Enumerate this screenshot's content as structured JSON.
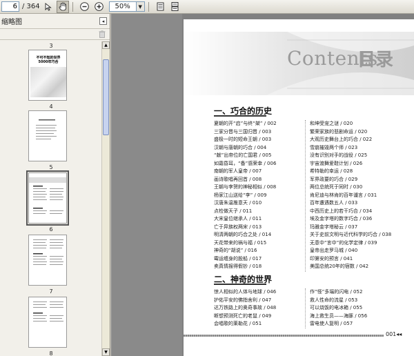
{
  "toolbar": {
    "current_page": "6",
    "page_total": "/ 364",
    "zoom": "50%"
  },
  "panel": {
    "title": "缩略图",
    "collapse_glyph": "◂"
  },
  "thumbnails": [
    {
      "label": "3"
    },
    {
      "label": "4",
      "cover_title": "不可不知的世界\n5000年巧合"
    },
    {
      "label": "5"
    },
    {
      "label": "6"
    },
    {
      "label": "7"
    },
    {
      "label": "8"
    }
  ],
  "page": {
    "banner_en": "Contents",
    "banner_cn": "目录",
    "page_number": "001◂◂"
  },
  "section1": {
    "title": "一、巧合的历史",
    "left": [
      "夏朝的开“启”与终“桀” / 002",
      "三家分晋与三国归晋 / 003",
      "盛极一时的短命王朝 / 003",
      "汉朝与唐朝的巧合 / 004",
      "“献”出帝位的亡国君 / 005",
      "如霜昏耳，“备”感荣幸 / 006",
      "南朝的军人皇帝 / 007",
      "画诗歌唱再回首 / 008",
      "王朝与李贺的神秘相似 / 008",
      "杨家江山送给“李” / 009",
      "汉唐朱温推意天 / 010",
      "点检做天子 / 011",
      "大宋皇位继承人 / 011",
      "亡于异族权两宋 / 013",
      "明清两朝的巧合之处 / 014",
      "天花带来的祸与福 / 015",
      "神奇的“胡说” / 016",
      "霉运缠身的股船 / 017",
      "卖真情报得假钞 / 018"
    ],
    "right": [
      "和坤受宠之谜 / 020",
      "繁荣家族的悲剧命运 / 020",
      "大观历史舞台上的巧合 / 022",
      "雪崩摧毁两个师 / 023",
      "没有识别对手的战役 / 025",
      "宇宙渡舞爱鞋计划 / 026",
      "希特勒的幸运 / 028",
      "军界政要的巧合 / 029",
      "两位总统死于同时 / 030",
      "肯尼迪与林肯的百年谶言 / 031",
      "百年遭遇数五人 / 033",
      "中西历史上的若干巧合 / 034",
      "埃及金字塔的数字巧合 / 036",
      "玛雅金字塔秘云 / 037",
      "关于史前文明与近代科学的巧合 / 038",
      "无意中“言中”的化学定律 / 039",
      "皇帝出走罗马城 / 040",
      "印第安的预言 / 041",
      "美国总统20年的宿数 / 042"
    ]
  },
  "section2": {
    "title": "二、神奇的世界",
    "left": [
      "惊人相似的人体与地球 / 046",
      "护佑平安的佛指舍利 / 047",
      "达万铁路上的奥奇事故 / 048",
      "断想预测死亡的老鼠 / 049",
      "会唱歌的莱勒花 / 051"
    ],
    "right": [
      "作“怪”多端的闪电 / 052",
      "救人性命的流星 / 053",
      "可以烧饭的电冰箱 / 055",
      "海上救生员——海豚 / 056",
      "雷电使人复明 / 057"
    ]
  },
  "colors": {
    "doc_bg": "#808080",
    "panel_bg": "#f2f0ea",
    "banner_gray": "#9a9a9a"
  },
  "icons": [
    "select-icon",
    "hand-icon",
    "zoom-out-icon",
    "zoom-in-icon",
    "single-page-icon",
    "continuous-page-icon",
    "trash-icon",
    "collapse-icon",
    "scroll-up-icon",
    "scroll-down-icon"
  ]
}
